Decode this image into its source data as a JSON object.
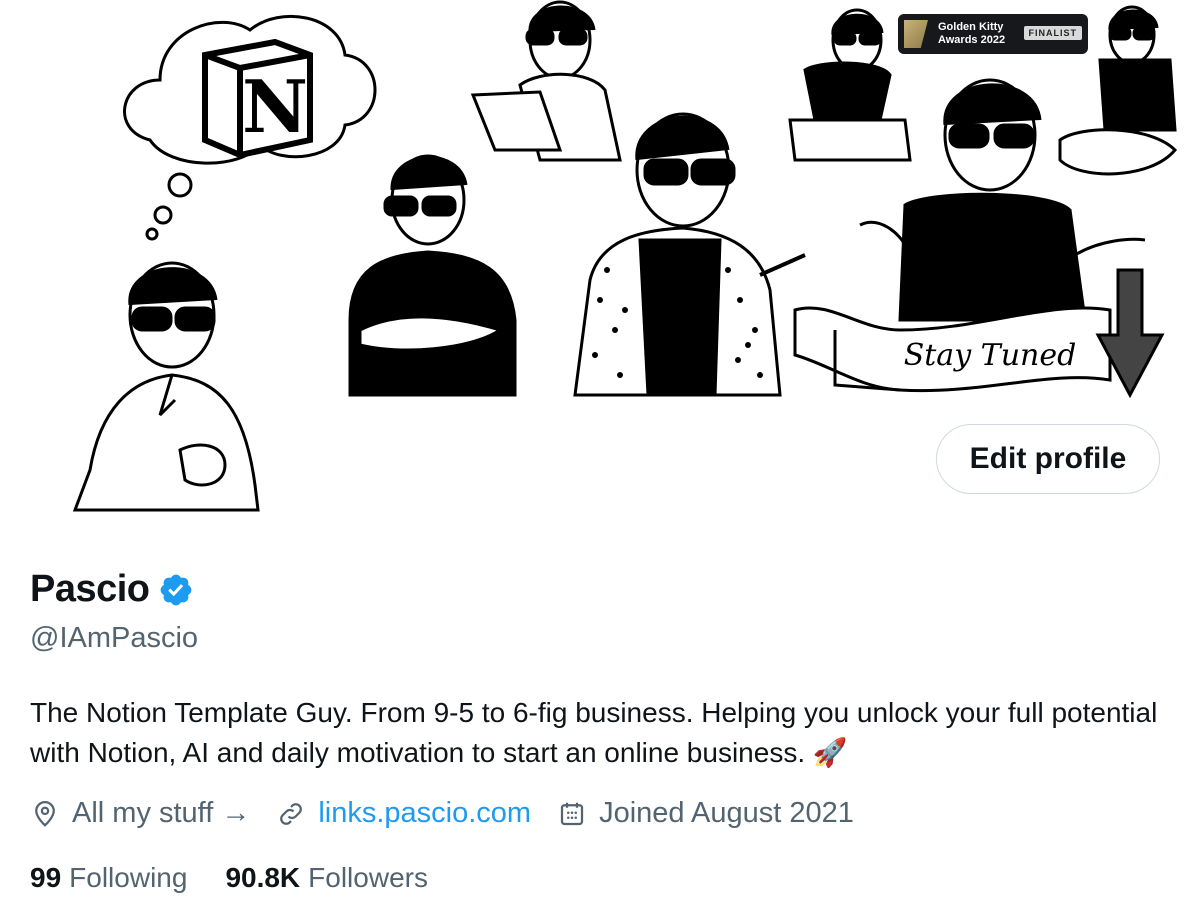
{
  "banner": {
    "notion_letter": "N",
    "badge": {
      "line1": "Golden Kitty",
      "line2": "Awards 2022",
      "tag": "FINALIST"
    },
    "ribbon_text": "Stay Tuned"
  },
  "profile": {
    "edit_label": "Edit profile",
    "name": "Pascio",
    "handle": "@IAmPascio",
    "bio": "The Notion Template Guy. From 9-5 to 6-fig business. Helping you unlock your full potential with Notion, AI and daily motivation to start an online business. 🚀",
    "location": "All my stuff →",
    "link": "links.pascio.com",
    "joined": "Joined August 2021",
    "following_count": "99",
    "following_label": "Following",
    "followers_count": "90.8K",
    "followers_label": "Followers"
  },
  "colors": {
    "accent": "#1d9bf0",
    "secondary_text": "#536471",
    "primary_text": "#0f1419",
    "border": "#cfd9de"
  },
  "icons": [
    "verified-badge-icon",
    "location-pin-icon",
    "link-icon",
    "calendar-icon",
    "rocket-icon"
  ]
}
